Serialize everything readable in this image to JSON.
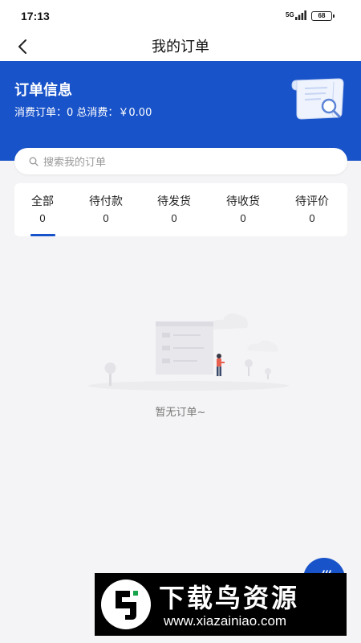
{
  "status_bar": {
    "time": "17:13",
    "network": "5G",
    "battery": "68"
  },
  "nav": {
    "title": "我的订单",
    "back_icon": "chevron-left-icon"
  },
  "order_info": {
    "title": "订单信息",
    "stats_text": "消费订单：0 总消费：￥0.00"
  },
  "search": {
    "placeholder": "搜索我的订单",
    "icon": "search-icon"
  },
  "tabs": [
    {
      "label": "全部",
      "count": "0",
      "active": true
    },
    {
      "label": "待付款",
      "count": "0",
      "active": false
    },
    {
      "label": "待发货",
      "count": "0",
      "active": false
    },
    {
      "label": "待收货",
      "count": "0",
      "active": false
    },
    {
      "label": "待评价",
      "count": "0",
      "active": false
    }
  ],
  "empty_state": {
    "message": "暂无订单~"
  },
  "watermark": {
    "title": "下载鸟资源",
    "url": "www.xiazainiao.com"
  },
  "colors": {
    "primary": "#1953c9",
    "background": "#f4f4f6"
  }
}
